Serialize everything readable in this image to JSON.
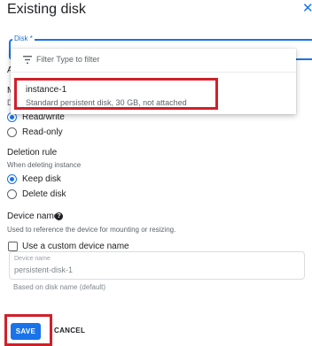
{
  "dialog": {
    "title": "Existing disk",
    "close_icon": "close-icon"
  },
  "disk_field": {
    "label": "Disk *"
  },
  "dropdown": {
    "filter_icon": "filter-icon",
    "filter_placeholder": "Filter Type to filter",
    "options": [
      {
        "title": "instance-1",
        "subtitle": "Standard persistent disk, 30 GB, not attached"
      }
    ]
  },
  "partial": {
    "attachment_head": "A",
    "mode_head": "M",
    "mode_sub": "Di"
  },
  "mode": {
    "options": [
      {
        "label": "Read/write",
        "selected": true
      },
      {
        "label": "Read-only",
        "selected": false
      }
    ]
  },
  "deletion_rule": {
    "title": "Deletion rule",
    "helper": "When deleting instance",
    "options": [
      {
        "label": "Keep disk",
        "selected": true
      },
      {
        "label": "Delete disk",
        "selected": false
      }
    ]
  },
  "device_name": {
    "title": "Device name",
    "help_icon": "help-icon",
    "helper": "Used to reference the device for mounting or resizing.",
    "custom_checkbox_label": "Use a custom device name",
    "custom_checked": false,
    "field_label": "Device name",
    "field_value": "persistent-disk-1",
    "field_helper": "Based on disk name (default)"
  },
  "actions": {
    "save_label": "SAVE",
    "cancel_label": "CANCEL"
  },
  "colors": {
    "accent": "#1a73e8",
    "highlight": "#d0202a"
  }
}
